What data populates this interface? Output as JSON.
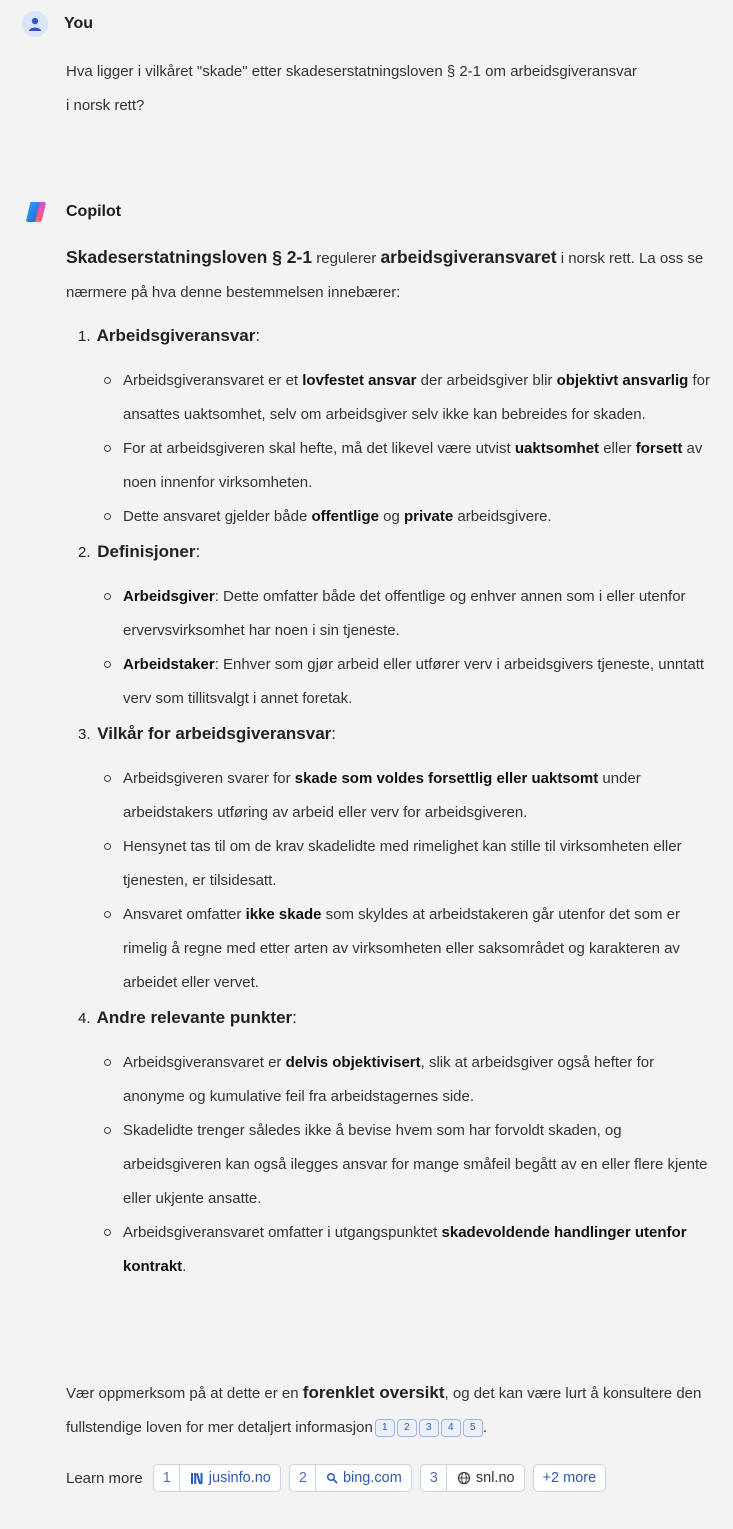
{
  "user": {
    "name": "You",
    "question_line1": "Hva ligger i vilkåret \"skade\" etter skadeserstatningsloven § 2-1 om arbeidsgiveransvar",
    "question_line2": "i norsk rett?"
  },
  "assistant": {
    "name": "Copilot",
    "intro": {
      "t1": "Skadeserstatningsloven § 2-1",
      "t2": " regulerer ",
      "t3": "arbeidsgiveransvaret",
      "t4": " i norsk rett. La oss se nærmere på hva denne bestemmelsen innebærer:"
    },
    "sections": [
      {
        "num": "1.",
        "title": "Arbeidsgiveransvar",
        "colon": ":",
        "items": [
          [
            {
              "t": "Arbeidsgiveransvaret er et "
            },
            {
              "t": "lovfestet ansvar",
              "b": true
            },
            {
              "t": " der arbeidsgiver blir "
            },
            {
              "t": "objektivt ansvarlig",
              "b": true
            },
            {
              "t": " for ansattes uaktsomhet, selv om arbeidsgiver selv ikke kan bebreides for skaden."
            }
          ],
          [
            {
              "t": "For at arbeidsgiveren skal hefte, må det likevel være utvist "
            },
            {
              "t": "uaktsomhet",
              "b": true
            },
            {
              "t": " eller "
            },
            {
              "t": "forsett",
              "b": true
            },
            {
              "t": " av noen innenfor virksomheten."
            }
          ],
          [
            {
              "t": "Dette ansvaret gjelder både "
            },
            {
              "t": "offentlige",
              "b": true
            },
            {
              "t": " og "
            },
            {
              "t": "private",
              "b": true
            },
            {
              "t": " arbeidsgivere."
            }
          ]
        ]
      },
      {
        "num": "2.",
        "title": "Definisjoner",
        "colon": ":",
        "items": [
          [
            {
              "t": "Arbeidsgiver",
              "b": true
            },
            {
              "t": ": Dette omfatter både det offentlige og enhver annen som i eller utenfor ervervsvirksomhet har noen i sin tjeneste."
            }
          ],
          [
            {
              "t": "Arbeidstaker",
              "b": true
            },
            {
              "t": ": Enhver som gjør arbeid eller utfører verv i arbeidsgivers tjeneste, unntatt verv som tillitsvalgt i annet foretak."
            }
          ]
        ]
      },
      {
        "num": "3.",
        "title": "Vilkår for arbeidsgiveransvar",
        "colon": ":",
        "items": [
          [
            {
              "t": "Arbeidsgiveren svarer for "
            },
            {
              "t": "skade som voldes forsettlig eller uaktsomt",
              "b": true
            },
            {
              "t": " under arbeidstakers utføring av arbeid eller verv for arbeidsgiveren."
            }
          ],
          [
            {
              "t": "Hensynet tas til om de krav skadelidte med rimelighet kan stille til virksomheten eller tjenesten, er tilsidesatt."
            }
          ],
          [
            {
              "t": "Ansvaret omfatter "
            },
            {
              "t": "ikke skade",
              "b": true
            },
            {
              "t": " som skyldes at arbeidstakeren går utenfor det som er rimelig å regne med etter arten av virksomheten eller saksområdet og karakteren av arbeidet eller vervet."
            }
          ]
        ]
      },
      {
        "num": "4.",
        "title": "Andre relevante punkter",
        "colon": ":",
        "items": [
          [
            {
              "t": "Arbeidsgiveransvaret er "
            },
            {
              "t": "delvis objektivisert",
              "b": true
            },
            {
              "t": ", slik at arbeidsgiver også hefter for anonyme og kumulative feil fra arbeidstagernes side."
            }
          ],
          [
            {
              "t": "Skadelidte trenger således ikke å bevise hvem som har forvoldt skaden, og arbeidsgiveren kan også ilegges ansvar for mange småfeil begått av en eller flere kjente eller ukjente ansatte."
            }
          ],
          [
            {
              "t": "Arbeidsgiveransvaret omfatter i utgangspunktet "
            },
            {
              "t": "skadevoldende handlinger utenfor kontrakt",
              "b": true
            },
            {
              "t": "."
            }
          ]
        ]
      }
    ],
    "closing": {
      "t1": "Vær oppmerksom på at dette er en ",
      "t2": "forenklet oversikt",
      "t3": ", og det kan være lurt å konsultere den fullstendige loven for mer detaljert informasjon"
    },
    "citations": [
      "1",
      "2",
      "3",
      "4",
      "5"
    ],
    "learn_more": {
      "label": "Learn more",
      "sources": [
        {
          "num": "1",
          "site": "jusinfo.no",
          "icon": "books-icon"
        },
        {
          "num": "2",
          "site": "bing.com",
          "icon": "search-icon"
        },
        {
          "num": "3",
          "site": "snl.no",
          "icon": "globe-icon"
        }
      ],
      "more": "+2 more"
    }
  }
}
